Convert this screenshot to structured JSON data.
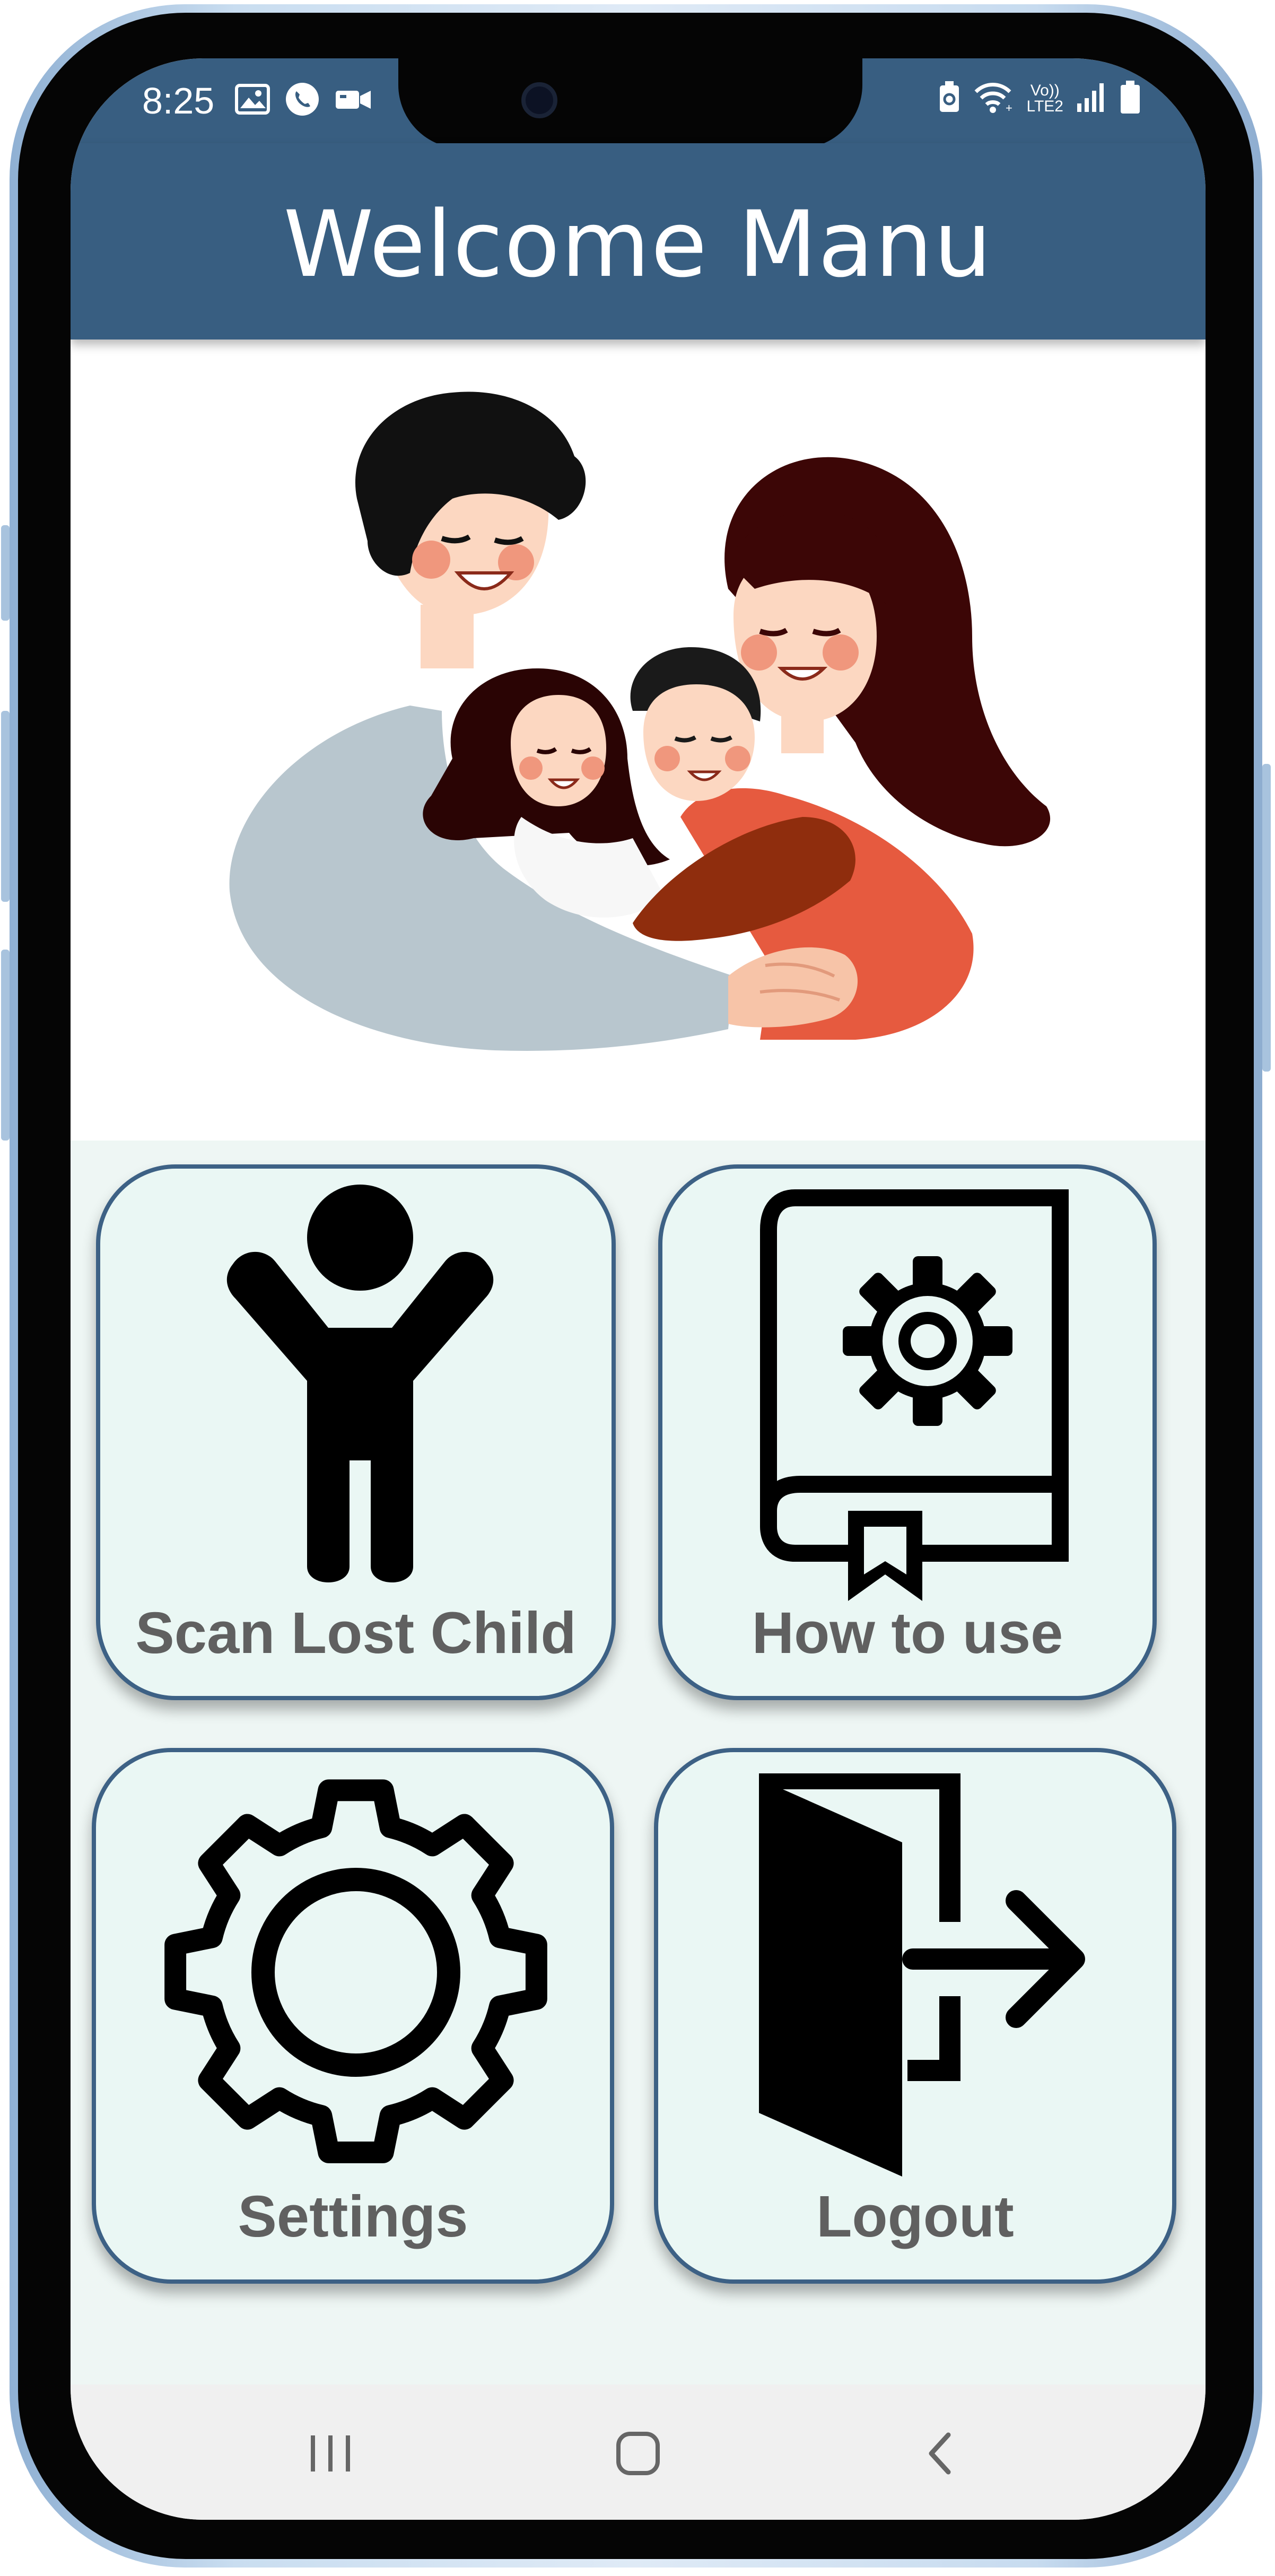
{
  "status_bar": {
    "time": "8:25",
    "left_icons": [
      "gallery-icon",
      "phone-call-icon",
      "video-icon"
    ],
    "right_icons": [
      "battery-saver-icon",
      "wifi-icon",
      "volte-icon",
      "signal-icon",
      "battery-icon"
    ],
    "volte_label": "Vo))",
    "lte_label": "LTE2"
  },
  "app_bar": {
    "title": "Welcome Manu"
  },
  "hero": {
    "image": "family-hug-illustration"
  },
  "tiles": [
    {
      "label": "Scan Lost Child",
      "icon": "child-icon"
    },
    {
      "label": "How to use",
      "icon": "manual-book-icon"
    },
    {
      "label": "Settings",
      "icon": "gear-icon"
    },
    {
      "label": "Logout",
      "icon": "logout-door-icon"
    }
  ],
  "nav_bar": {
    "buttons": [
      "recent-apps-icon",
      "home-icon",
      "back-icon"
    ]
  },
  "colors": {
    "primary": "#385e81",
    "tile_bg": "#eaf7f4",
    "tile_border": "#3d6185",
    "label": "#606060"
  }
}
